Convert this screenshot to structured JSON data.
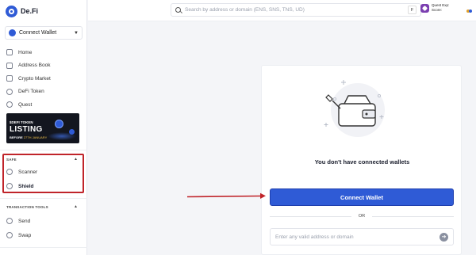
{
  "app": {
    "logo_text": "De.Fi"
  },
  "sidebar": {
    "connect_label": "Connect Wallet",
    "nav": [
      {
        "label": "Home",
        "icon": "home-icon"
      },
      {
        "label": "Address Book",
        "icon": "book-icon"
      },
      {
        "label": "Crypto Market",
        "icon": "chart-icon"
      },
      {
        "label": "DeFi Token",
        "icon": "token-icon"
      },
      {
        "label": "Quest",
        "icon": "quest-icon"
      }
    ],
    "banner": {
      "line1": "$DEFI TOKEN",
      "line2": "LISTING",
      "line3_prefix": "BEFORE ",
      "line3_date": "27TH JANUARY"
    },
    "safe": {
      "title": "SAFE",
      "items": [
        {
          "label": "Scanner",
          "icon": "scanner-icon"
        },
        {
          "label": "Shield",
          "icon": "shield-icon"
        }
      ]
    },
    "tools": {
      "title": "TRANSACTION TOOLS",
      "items": [
        {
          "label": "Send",
          "icon": "send-icon"
        },
        {
          "label": "Swap",
          "icon": "swap-icon"
        }
      ]
    }
  },
  "topbar": {
    "search_placeholder": "Search by address or domain (ENS, SNS, TNS, UD)",
    "search_shortcut": "F",
    "user_line1": "Quest Exp:",
    "user_line2": "Score:"
  },
  "main": {
    "empty_text": "You don't have connected wallets",
    "connect_button": "Connect Wallet",
    "or_text": "OR",
    "address_placeholder": "Enter any valid address or domain"
  },
  "colors": {
    "accent": "#2f5bd6",
    "highlight_box": "#c0242a",
    "arrow": "#c0242a"
  }
}
